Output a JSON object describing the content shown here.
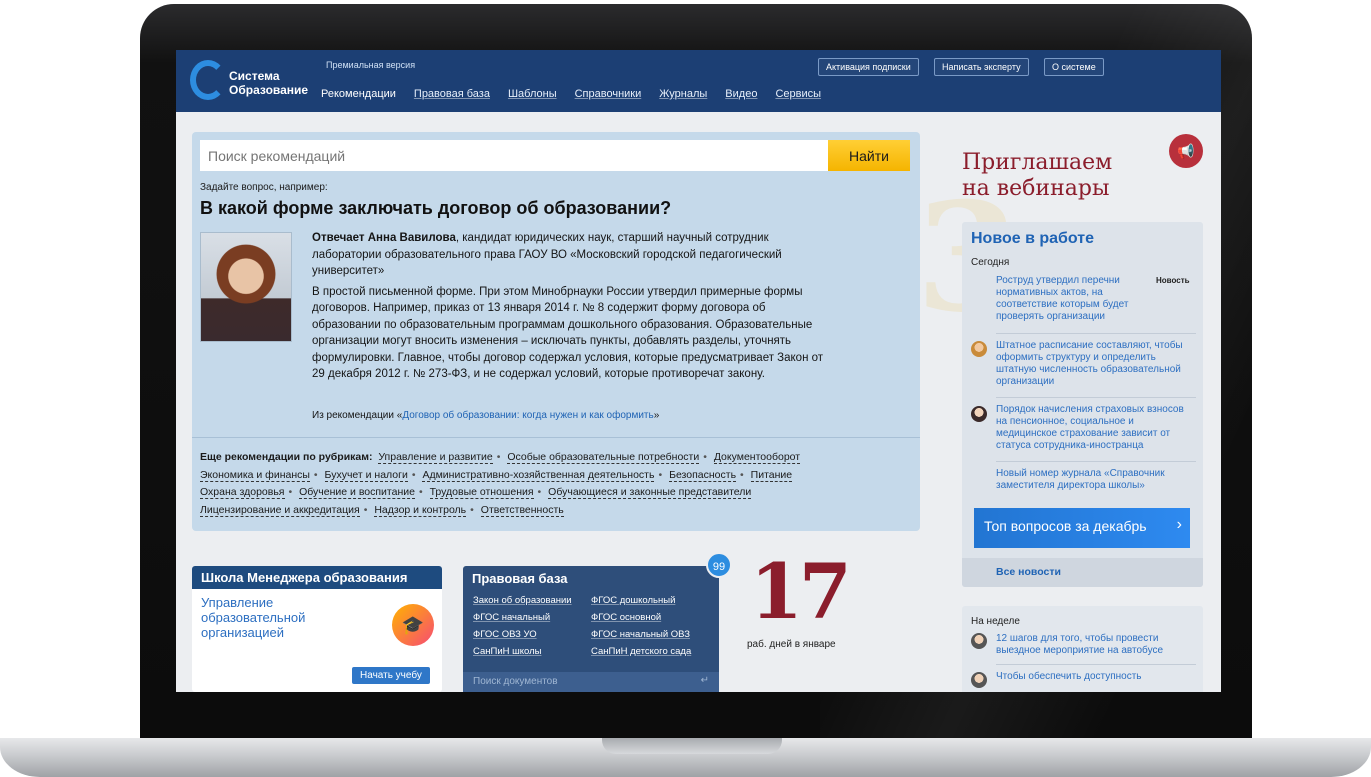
{
  "header": {
    "logo_line1": "Система",
    "logo_line2": "Образование",
    "premium": "Премиальная версия",
    "nav": [
      "Рекомендации",
      "Правовая база",
      "Шаблоны",
      "Справочники",
      "Журналы",
      "Видео",
      "Сервисы"
    ],
    "buttons": [
      "Активация подписки",
      "Написать эксперту",
      "О системе"
    ]
  },
  "search": {
    "placeholder": "Поиск рекомендаций",
    "button": "Найти",
    "hint": "Задайте вопрос, например:",
    "question": "В какой форме заключать договор об образовании?"
  },
  "answer": {
    "author": "Отвечает Анна Вавилова",
    "author_desc": ", кандидат юридических наук, старший научный сотрудник лаборатории образовательного права ГАОУ ВО «Московский городской педагогический университет»",
    "text": "В простой письменной форме. При этом Минобрнауки России утвердил примерные формы договоров. Например, приказ от 13 января 2014 г. № 8 содержит форму договора об образовании по образовательным программам дошкольного образования. Образовательные организации могут вносить изменения – исключать пункты, добавлять разделы, уточнять формулировки. Главное, чтобы договор содержал условия, которые предусматривает Закон от 29 декабря 2012 г. № 273-ФЗ, и не содержал условий, которые противоречат закону.",
    "from_prefix": "Из рекомендации «",
    "from_link": "Договор об образовании: когда нужен и как оформить",
    "from_suffix": "»"
  },
  "rubrics": {
    "title": "Еще рекомендации по рубрикам:",
    "items": [
      "Управление и развитие",
      "Особые образовательные потребности",
      "Документооборот",
      "Экономика и финансы",
      "Бухучет и налоги",
      "Административно-хозяйственная деятельность",
      "Безопасность",
      "Питание",
      "Охрана здоровья",
      "Обучение и воспитание",
      "Трудовые отношения",
      "Обучающиеся и законные представители",
      "Лицензирование и аккредитация",
      "Надзор и контроль",
      "Ответственность"
    ]
  },
  "school": {
    "title": "Школа Менеджера образования",
    "course": "Управление образовательной организацией",
    "button": "Начать учебу"
  },
  "law": {
    "title": "Правовая база",
    "badge": "99",
    "links": [
      "Закон об образовании",
      "ФГОС дошкольный",
      "ФГОС начальный",
      "ФГОС основной",
      "ФГОС ОВЗ УО",
      "ФГОС начальный ОВЗ",
      "СанПиН школы",
      "СанПиН детского сада"
    ],
    "search_placeholder": "Поиск документов"
  },
  "days": {
    "number": "17",
    "label": "раб. дней в январе"
  },
  "webinar": {
    "line1": "Приглашаем",
    "line2": "на вебинары"
  },
  "news": {
    "title": "Новое в работе",
    "today": "Сегодня",
    "tag": "Новость",
    "items": [
      "Роструд утвердил перечни нормативных актов, на соответствие которым будет проверять организации",
      "Штатное расписание составляют, чтобы оформить структуру и определить штатную численность образовательной организации",
      "Порядок начисления страховых взносов на пенсионное, социальное и медицинское страхование зависит от статуса сотрудника-иностранца",
      "Новый номер журнала «Справочник заместителя директора школы»"
    ],
    "top_questions": "Топ вопросов за декабрь",
    "all_news": "Все новости"
  },
  "week": {
    "title": "На неделе",
    "items": [
      "12 шагов для того, чтобы провести выездное мероприятие на автобусе",
      "Чтобы обеспечить доступность"
    ]
  }
}
